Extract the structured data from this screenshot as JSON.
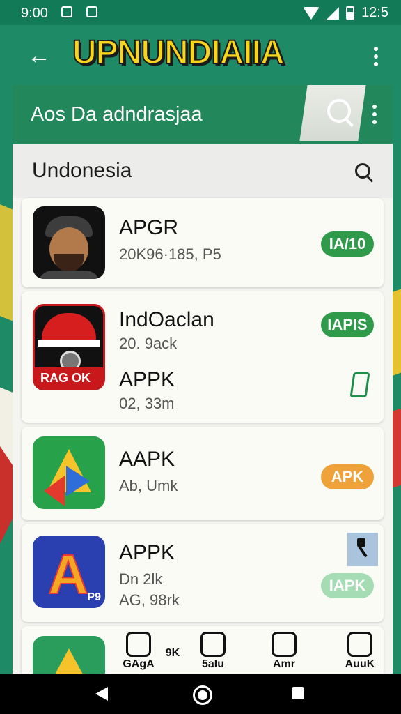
{
  "status_bar": {
    "time": "9:00",
    "battery_time": "12:5"
  },
  "header": {
    "title": "UPNUNDIAIIA"
  },
  "subheader": {
    "title": "Aos Da adndrasjaa"
  },
  "country_bar": {
    "label": "Undonesia"
  },
  "apps": [
    {
      "name": "APGR",
      "meta": "20K96·185, P5",
      "badge": "IA/10",
      "badge_color": "#2e9a4a"
    },
    {
      "name": "IndOaclan",
      "meta": "20. 9ack",
      "badge": "IAPIS",
      "badge_color": "#2e9a4a",
      "icon_text": "RAG OK"
    },
    {
      "name": "APPK",
      "meta": "02, 33m"
    },
    {
      "name": "AAPK",
      "meta": "Ab, Umk",
      "badge": "APK",
      "badge_color": "#f0a23a"
    },
    {
      "name": "APPK",
      "meta": "Dn 2lk",
      "meta2": "AG, 98rk",
      "badge": "IAPK",
      "badge_color": "#a6dcb3",
      "icon_text": "P9"
    }
  ],
  "bottom_row": {
    "labels": [
      "GAgA",
      "9K",
      "5aIu",
      "Amr",
      "AuuK"
    ]
  },
  "colors": {
    "primary": "#1f8a66",
    "accent_yellow": "#f7d51d",
    "card_bg": "#fbfbf6"
  },
  "icons": [
    "back-arrow-icon",
    "kebab-menu-icon",
    "search-icon",
    "bookmark-icon",
    "hammer-icon",
    "wifi-icon",
    "signal-icon",
    "battery-icon"
  ]
}
